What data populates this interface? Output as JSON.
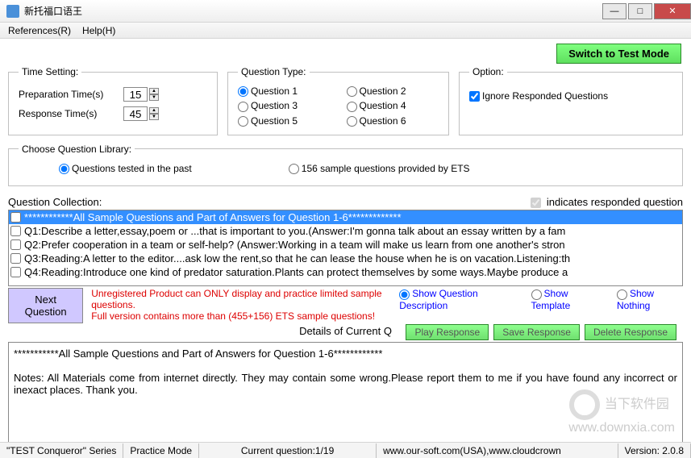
{
  "window": {
    "title": "新托福口语王"
  },
  "menu": {
    "references": "References(R)",
    "help": "Help(H)"
  },
  "switch_btn": "Switch to Test Mode",
  "time": {
    "legend": "Time Setting:",
    "prep_label": "Preparation Time(s)",
    "prep_value": "15",
    "resp_label": "Response Time(s)",
    "resp_value": "45"
  },
  "qtype": {
    "legend": "Question Type:",
    "q1": "Question 1",
    "q2": "Question 2",
    "q3": "Question 3",
    "q4": "Question 4",
    "q5": "Question 5",
    "q6": "Question 6"
  },
  "option": {
    "legend": "Option:",
    "ignore": "Ignore Responded Questions"
  },
  "lib": {
    "legend": "Choose Question Library:",
    "past": "Questions tested in the past",
    "ets": "156 sample questions provided by ETS"
  },
  "qcoll": {
    "label": "Question Collection:",
    "indicator": "indicates responded question",
    "items": [
      "************All Sample Questions and Part of Answers for Question 1-6*************",
      "Q1:Describe a letter,essay,poem or ...that is important to you.(Answer:I'm gonna talk about an essay written by a fam",
      "Q2:Prefer cooperation in a team or self-help? (Answer:Working in a team will make us learn from one another's stron",
      "Q3:Reading:A letter to the editor....ask low the rent,so that he can lease the house when he is on vacation.Listening:th",
      "Q4:Reading:Introduce one kind of predator saturation.Plants can protect themselves by some ways.Maybe produce a"
    ]
  },
  "nextq": "Next Question",
  "warn": {
    "line1": "Unregistered Product can ONLY display and practice limited sample questions.",
    "line2": "Full version contains more than (455+156) ETS sample questions!"
  },
  "showopts": {
    "desc": "Show Question Description",
    "tmpl": "Show Template",
    "none": "Show Nothing"
  },
  "detail_head": "Details of Current Q",
  "resp_btns": {
    "play": "Play Response",
    "save": "Save Response",
    "del": "Delete Response"
  },
  "detail_text1": "***********All Sample Questions and Part of Answers for Question 1-6************",
  "detail_text2": "Notes: All Materials come from internet directly. They may contain some wrong.Please report them to me if you have found any incorrect or inexact places. Thank you.",
  "status": {
    "series": "\"TEST Conqueror\" Series",
    "mode": "Practice Mode",
    "current": "Current question:1/19",
    "sites": "www.our-soft.com(USA),www.cloudcrown",
    "version": "Version: 2.0.8"
  },
  "watermark": "当下软件园\nwww.downxia.com"
}
